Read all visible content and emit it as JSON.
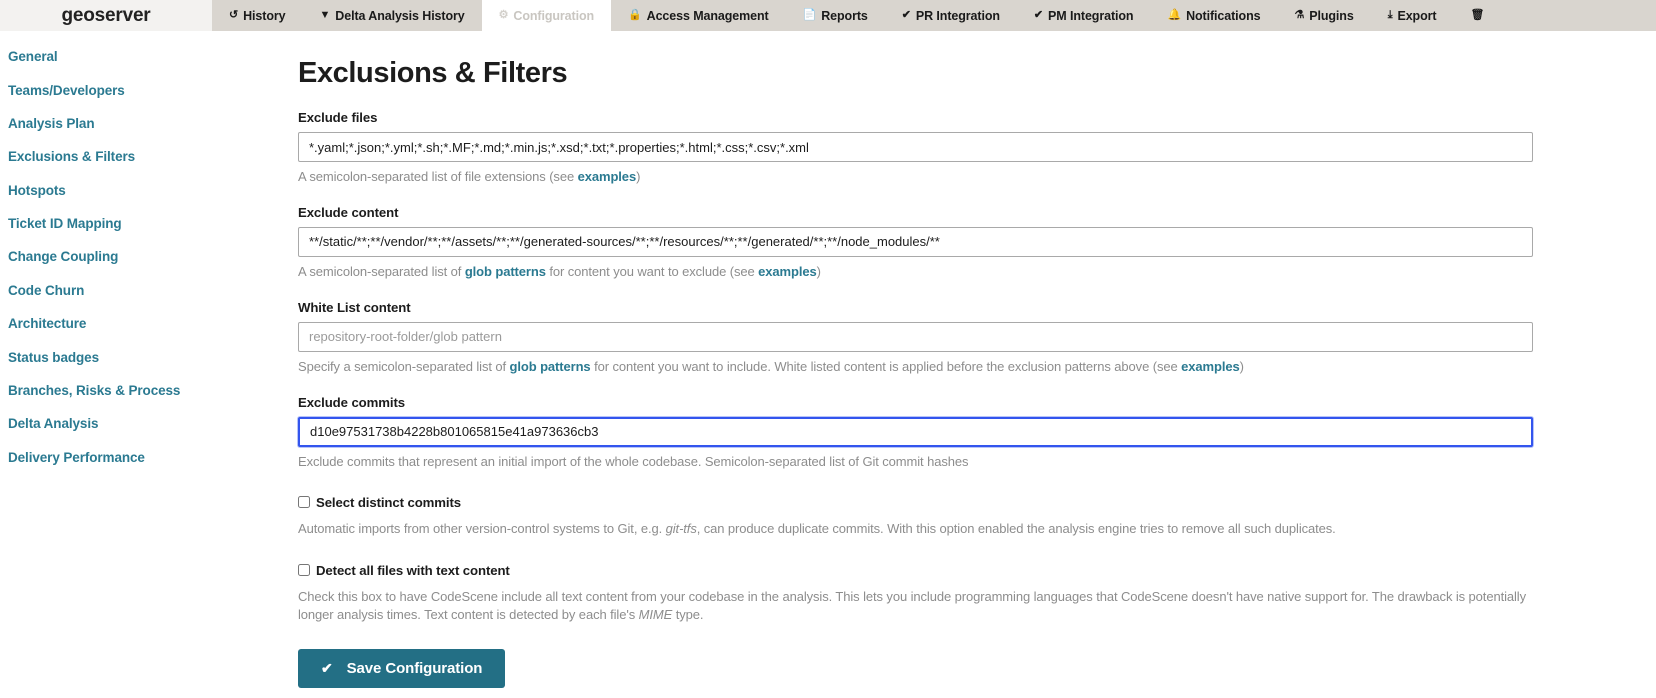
{
  "brand": "geoserver",
  "topnav": {
    "items": [
      {
        "label": "History",
        "icon": "history-icon",
        "glyph": "↺",
        "active": false
      },
      {
        "label": "Delta Analysis History",
        "icon": "filter-icon",
        "glyph": "▼",
        "active": false
      },
      {
        "label": "Configuration",
        "icon": "gears-icon",
        "glyph": "⚙",
        "active": true
      },
      {
        "label": "Access Management",
        "icon": "lock-icon",
        "glyph": "🔒",
        "active": false
      },
      {
        "label": "Reports",
        "icon": "document-icon",
        "glyph": "📄",
        "active": false
      },
      {
        "label": "PR Integration",
        "icon": "check-icon",
        "glyph": "✔",
        "active": false
      },
      {
        "label": "PM Integration",
        "icon": "check-icon",
        "glyph": "✔",
        "active": false
      },
      {
        "label": "Notifications",
        "icon": "bell-icon",
        "glyph": "🔔",
        "active": false
      },
      {
        "label": "Plugins",
        "icon": "plug-icon",
        "glyph": "⚗",
        "active": false
      },
      {
        "label": "Export",
        "icon": "download-icon",
        "glyph": "⤓",
        "active": false
      },
      {
        "label": "",
        "icon": "trash-icon",
        "glyph": "🗑",
        "active": false
      }
    ]
  },
  "sidebar": {
    "items": [
      {
        "label": "General"
      },
      {
        "label": "Teams/Developers"
      },
      {
        "label": "Analysis Plan"
      },
      {
        "label": "Exclusions & Filters"
      },
      {
        "label": "Hotspots"
      },
      {
        "label": "Ticket ID Mapping"
      },
      {
        "label": "Change Coupling"
      },
      {
        "label": "Code Churn"
      },
      {
        "label": "Architecture"
      },
      {
        "label": "Status badges"
      },
      {
        "label": "Branches, Risks & Process"
      },
      {
        "label": "Delta Analysis"
      },
      {
        "label": "Delivery Performance"
      }
    ]
  },
  "main": {
    "title": "Exclusions & Filters",
    "exclude_files": {
      "label": "Exclude files",
      "value": "*.yaml;*.json;*.yml;*.sh;*.MF;*.md;*.min.js;*.xsd;*.txt;*.properties;*.html;*.css;*.csv;*.xml",
      "placeholder": "",
      "help_pre": "A semicolon-separated list of file extensions (see ",
      "help_link": "examples",
      "help_post": ")"
    },
    "exclude_content": {
      "label": "Exclude content",
      "value": "**/static/**;**/vendor/**;**/assets/**;**/generated-sources/**;**/resources/**;**/generated/**;**/node_modules/**",
      "placeholder": "",
      "help_pre": "A semicolon-separated list of ",
      "help_link1": "glob patterns",
      "help_mid": " for content you want to exclude (see ",
      "help_link2": "examples",
      "help_post": ")"
    },
    "white_list": {
      "label": "White List content",
      "value": "",
      "placeholder": "repository-root-folder/glob pattern",
      "help_pre": "Specify a semicolon-separated list of ",
      "help_link1": "glob patterns",
      "help_mid": " for content you want to include. White listed content is applied before the exclusion patterns above (see ",
      "help_link2": "examples",
      "help_post": ")"
    },
    "exclude_commits": {
      "label": "Exclude commits",
      "value": "d10e97531738b4228b801065815e41a973636cb3",
      "placeholder": "",
      "help": "Exclude commits that represent an initial import of the whole codebase. Semicolon-separated list of Git commit hashes",
      "focused": true
    },
    "select_distinct": {
      "label": "Select distinct commits",
      "checked": false,
      "help_pre": "Automatic imports from other version-control systems to Git, e.g. ",
      "help_em": "git-tfs",
      "help_post": ", can produce duplicate commits. With this option enabled the analysis engine tries to remove all such duplicates."
    },
    "detect_text": {
      "label": "Detect all files with text content",
      "checked": false,
      "help_pre": "Check this box to have CodeScene include all text content from your codebase in the analysis. This lets you include programming languages that CodeScene doesn't have native support for. The drawback is potentially longer analysis times. Text content is detected by each file's ",
      "help_em": "MIME",
      "help_post": " type."
    },
    "save_button": {
      "label": "Save Configuration",
      "icon": "check-icon",
      "glyph": "✔"
    }
  },
  "colors": {
    "accent": "#2b7a91",
    "button": "#236f85",
    "navbar": "#d9d5cf",
    "focus": "#3355ee"
  }
}
